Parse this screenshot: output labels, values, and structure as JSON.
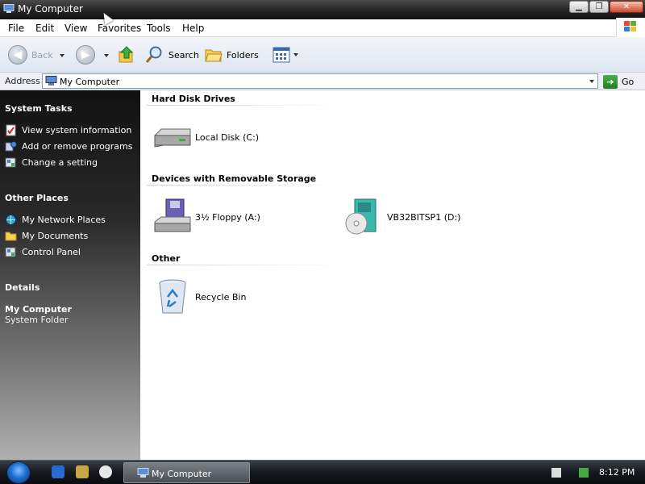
{
  "window": {
    "title": "My Computer",
    "controls": [
      "minimize",
      "maximize",
      "close"
    ]
  },
  "menubar": {
    "items": [
      "File",
      "Edit",
      "View",
      "Favorites",
      "Tools",
      "Help"
    ]
  },
  "toolbar": {
    "back_label": "Back",
    "search_label": "Search",
    "folders_label": "Folders"
  },
  "address": {
    "label": "Address",
    "value": "My Computer",
    "go_label": "Go"
  },
  "sidebar": {
    "system_tasks": {
      "heading": "System Tasks",
      "items": [
        {
          "label": "View system information",
          "icon": "system-info-icon"
        },
        {
          "label": "Add or remove programs",
          "icon": "add-remove-programs-icon"
        },
        {
          "label": "Change a setting",
          "icon": "control-panel-icon"
        }
      ]
    },
    "other_places": {
      "heading": "Other Places",
      "items": [
        {
          "label": "My Network Places",
          "icon": "network-places-icon"
        },
        {
          "label": "My Documents",
          "icon": "documents-folder-icon"
        },
        {
          "label": "Control Panel",
          "icon": "control-panel-icon"
        }
      ]
    },
    "details": {
      "heading": "Details",
      "title": "My Computer",
      "subtitle": "System Folder"
    }
  },
  "content": {
    "groups": [
      {
        "heading": "Hard Disk Drives",
        "items": [
          {
            "label": "Local Disk (C:)",
            "icon": "hard-disk-icon"
          }
        ]
      },
      {
        "heading": "Devices with Removable Storage",
        "items": [
          {
            "label": "3½ Floppy (A:)",
            "icon": "floppy-drive-icon"
          },
          {
            "label": "VB32BITSP1 (D:)",
            "icon": "cd-drive-icon"
          }
        ]
      },
      {
        "heading": "Other",
        "items": [
          {
            "label": "Recycle Bin",
            "icon": "recycle-bin-icon"
          }
        ]
      }
    ]
  },
  "taskbar": {
    "active_task": "My Computer",
    "clock": "8:12 PM"
  },
  "colors": {
    "sidebar_top": "#111111",
    "sidebar_bottom": "#b0b0b0",
    "taskbar": "#15181c",
    "go_green": "#1e7e1e"
  }
}
